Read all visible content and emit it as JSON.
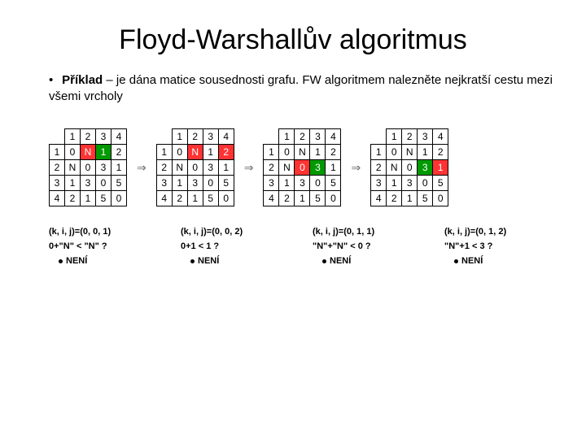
{
  "title": "Floyd-Warshallův algoritmus",
  "desc_label": "Příklad",
  "desc_text": " – je dána matice sousednosti grafu. FW algoritmem nalezněte nejkratší cestu mezi všemi vrcholy",
  "headers": [
    "1",
    "2",
    "3",
    "4"
  ],
  "matrices": [
    {
      "rows": [
        [
          "1",
          "0",
          "N",
          "1",
          "2"
        ],
        [
          "2",
          "N",
          "0",
          "3",
          "1"
        ],
        [
          "3",
          "1",
          "3",
          "0",
          "5"
        ],
        [
          "4",
          "2",
          "1",
          "5",
          "0"
        ]
      ],
      "redCells": [
        [
          0,
          1
        ]
      ],
      "greenCells": [
        [
          0,
          2
        ]
      ]
    },
    {
      "rows": [
        [
          "1",
          "0",
          "N",
          "1",
          "2"
        ],
        [
          "2",
          "N",
          "0",
          "3",
          "1"
        ],
        [
          "3",
          "1",
          "3",
          "0",
          "5"
        ],
        [
          "4",
          "2",
          "1",
          "5",
          "0"
        ]
      ],
      "redCells": [
        [
          0,
          1
        ],
        [
          0,
          3
        ]
      ],
      "greenCells": []
    },
    {
      "rows": [
        [
          "1",
          "0",
          "N",
          "1",
          "2"
        ],
        [
          "2",
          "N",
          "0",
          "3",
          "1"
        ],
        [
          "3",
          "1",
          "3",
          "0",
          "5"
        ],
        [
          "4",
          "2",
          "1",
          "5",
          "0"
        ]
      ],
      "redCells": [
        [
          1,
          1
        ]
      ],
      "greenCells": [
        [
          1,
          2
        ]
      ]
    },
    {
      "rows": [
        [
          "1",
          "0",
          "N",
          "1",
          "2"
        ],
        [
          "2",
          "N",
          "0",
          "3",
          "1"
        ],
        [
          "3",
          "1",
          "3",
          "0",
          "5"
        ],
        [
          "4",
          "2",
          "1",
          "5",
          "0"
        ]
      ],
      "redCells": [
        [
          1,
          3
        ]
      ],
      "greenCells": [
        [
          1,
          2
        ]
      ]
    }
  ],
  "steps": [
    {
      "l1": "(k, i, j)=(0, 0, 1)",
      "l2": "0+\"N\" < \"N\" ?",
      "neni": "NENÍ"
    },
    {
      "l1": "(k, i, j)=(0, 0, 2)",
      "l2": "0+1 < 1 ?",
      "neni": "NENÍ"
    },
    {
      "l1": "(k, i, j)=(0, 1, 1)",
      "l2": "\"N\"+\"N\" < 0 ?",
      "neni": "NENÍ"
    },
    {
      "l1": "(k, i, j)=(0, 1, 2)",
      "l2": "\"N\"+1 < 3 ?",
      "neni": "NENÍ"
    }
  ],
  "arrow": "⇒"
}
